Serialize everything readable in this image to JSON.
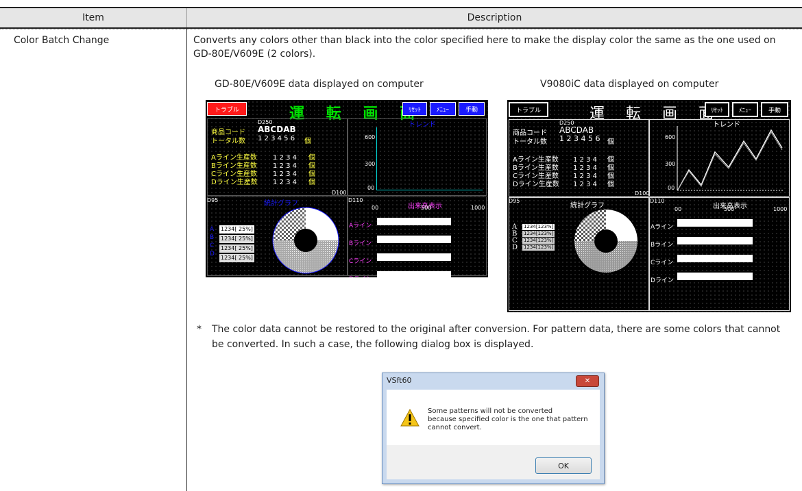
{
  "table": {
    "header_item": "Item",
    "header_description": "Description",
    "row_item": "Color Batch Change",
    "row_description": "Converts any colors other than black into the color specified here to make the display color the same as the one used on GD-80E/V609E (2 colors)."
  },
  "captions": {
    "left": "GD-80E/V609E data displayed on computer",
    "right": "V9080iC data displayed on computer"
  },
  "screen": {
    "trouble": "トラブル",
    "title_chars": [
      "運",
      "転",
      "画",
      "面"
    ],
    "reset": "ﾘｾｯﾄ",
    "menu": "ﾒﾆｭｰ",
    "manual": "手動",
    "d250": "D250",
    "product_code_label": "商品コード",
    "product_code_value": "ABCDAB",
    "total_label": "トータル数",
    "total_value": "1 2 3 4 5 6",
    "unit": "個",
    "lines": [
      "Aライン生産数",
      "Bライン生産数",
      "Cライン生産数",
      "Dライン生産数"
    ],
    "line_value": "1 2 3 4",
    "trend": "トレンド",
    "y_ticks": [
      "600",
      "300",
      "00"
    ],
    "d100": "D100",
    "d95": "D95",
    "d110": "D110",
    "stats_graph": "統計グラフ",
    "output_display": "出来高表示",
    "scale": [
      "00",
      "500",
      "1000"
    ],
    "legend_letters": [
      "A",
      "B",
      "C",
      "D"
    ],
    "legend_value_left": "1234[ 25%]",
    "legend_value_right": "1234[123%]",
    "line_labels": [
      "Aライン",
      "Bライン",
      "Cライン",
      "Dライン"
    ]
  },
  "note": {
    "mark": "*",
    "text": "The color data cannot be restored to the original after conversion. For pattern data, there are some colors that cannot be converted. In such a case, the following dialog box is displayed."
  },
  "dialog": {
    "title": "VSft60",
    "close": "✕",
    "message_line1": "Some patterns will not be converted",
    "message_line2": "because specified color is the one that pattern",
    "message_line3": "cannot convert.",
    "ok": "OK"
  }
}
